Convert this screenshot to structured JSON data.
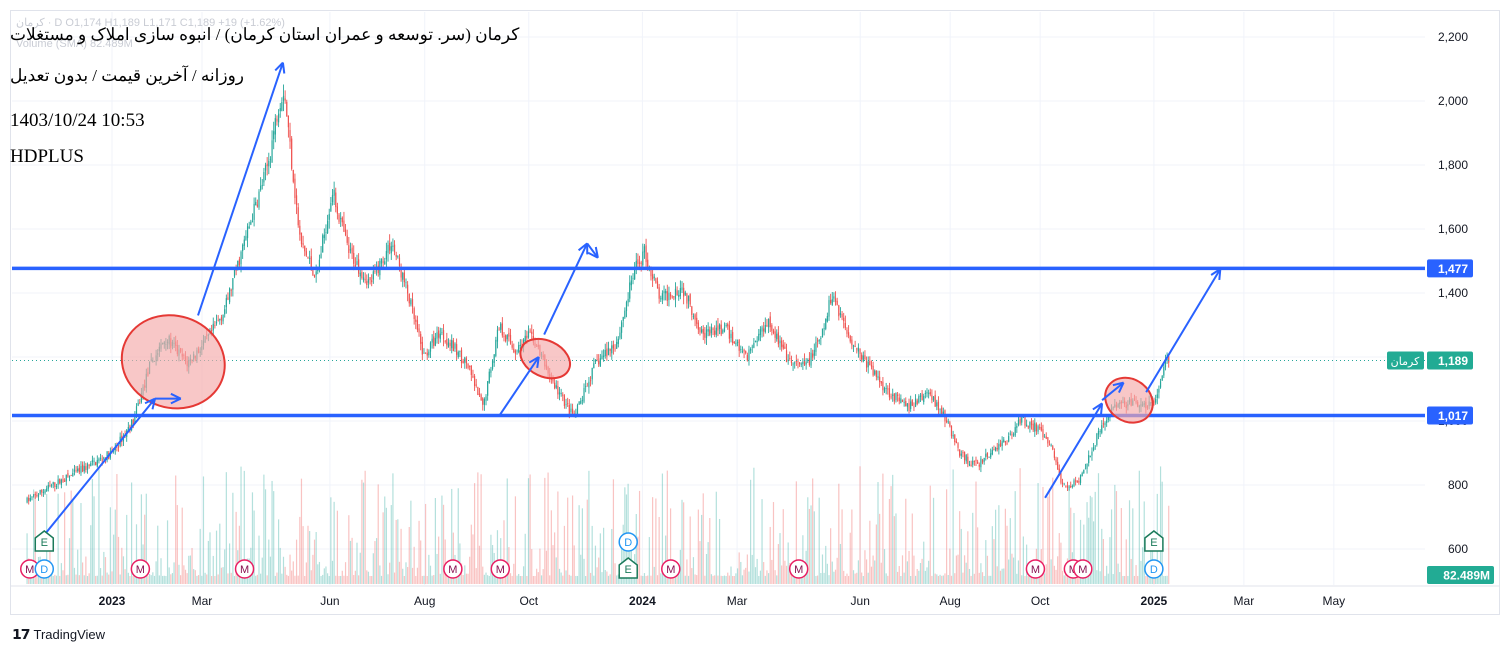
{
  "header": {
    "ohlc_ghost": "کرمان · D  O1,174  H1,189  L1,171  C1,189  +19 (+1.62%)",
    "volume_ghost": "Volume (SMA)  82.489M",
    "title": "کرمان (سر. توسعه و عمران استان کرمان) / انبوه سازی املاک و مستغلات",
    "subtitle": "روزانه / آخرین قیمت / بدون تعدیل",
    "datetime": "1403/10/24 10:53",
    "watermark": "HDPLUS"
  },
  "footer": {
    "brand": "TradingView"
  },
  "colors": {
    "up": "#26a69a",
    "down": "#ef5350",
    "level_line": "#2962ff",
    "annotation": "#2962ff",
    "ellipse_fill": "#f4a9a9",
    "ellipse_stroke": "#e53935",
    "grid": "#f0f3fa",
    "axis_text": "#131722",
    "badge_blue": "#2962ff",
    "badge_green": "#22ab94"
  },
  "chart_data": {
    "type": "candlestick",
    "symbol": "کرمان",
    "interval": "daily",
    "ylim": [
      540,
      2270
    ],
    "y_ticks": [
      600,
      800,
      1000,
      1200,
      1400,
      1600,
      1800,
      2000,
      2200
    ],
    "y_tick_labels": [
      "600",
      "800",
      "1,000",
      "1,200",
      "1,400",
      "1,600",
      "1,800",
      "2,000",
      "2,200"
    ],
    "x_tick_labels": [
      {
        "label": "2023",
        "bold": true,
        "t": 0.0
      },
      {
        "label": "Mar",
        "bold": false,
        "t": 0.0837
      },
      {
        "label": "Jun",
        "bold": false,
        "t": 0.2027
      },
      {
        "label": "Aug",
        "bold": false,
        "t": 0.2909
      },
      {
        "label": "Oct",
        "bold": false,
        "t": 0.3877
      },
      {
        "label": "2024",
        "bold": true,
        "t": 0.4934
      },
      {
        "label": "Mar",
        "bold": false,
        "t": 0.5815
      },
      {
        "label": "Jun",
        "bold": false,
        "t": 0.696
      },
      {
        "label": "Aug",
        "bold": false,
        "t": 0.7797
      },
      {
        "label": "Oct",
        "bold": false,
        "t": 0.8634
      },
      {
        "label": "2025",
        "bold": true,
        "t": 0.9692
      },
      {
        "label": "Mar",
        "bold": false,
        "t": 1.0529
      },
      {
        "label": "May",
        "bold": false,
        "t": 1.1366
      }
    ],
    "price_path": [
      [
        -0.079,
        750
      ],
      [
        -0.06,
        790
      ],
      [
        -0.03,
        845
      ],
      [
        0.0,
        900
      ],
      [
        0.02,
        1000
      ],
      [
        0.035,
        1170
      ],
      [
        0.05,
        1260
      ],
      [
        0.07,
        1180
      ],
      [
        0.09,
        1260
      ],
      [
        0.105,
        1350
      ],
      [
        0.125,
        1580
      ],
      [
        0.145,
        1800
      ],
      [
        0.155,
        1990
      ],
      [
        0.16,
        2040
      ],
      [
        0.175,
        1560
      ],
      [
        0.19,
        1450
      ],
      [
        0.205,
        1720
      ],
      [
        0.22,
        1530
      ],
      [
        0.24,
        1430
      ],
      [
        0.26,
        1560
      ],
      [
        0.275,
        1400
      ],
      [
        0.29,
        1200
      ],
      [
        0.305,
        1280
      ],
      [
        0.33,
        1180
      ],
      [
        0.345,
        1040
      ],
      [
        0.36,
        1300
      ],
      [
        0.375,
        1220
      ],
      [
        0.39,
        1270
      ],
      [
        0.41,
        1120
      ],
      [
        0.43,
        1010
      ],
      [
        0.45,
        1180
      ],
      [
        0.47,
        1250
      ],
      [
        0.485,
        1460
      ],
      [
        0.495,
        1530
      ],
      [
        0.51,
        1380
      ],
      [
        0.53,
        1420
      ],
      [
        0.55,
        1270
      ],
      [
        0.57,
        1290
      ],
      [
        0.59,
        1200
      ],
      [
        0.61,
        1320
      ],
      [
        0.63,
        1180
      ],
      [
        0.645,
        1170
      ],
      [
        0.66,
        1260
      ],
      [
        0.67,
        1400
      ],
      [
        0.685,
        1270
      ],
      [
        0.7,
        1190
      ],
      [
        0.72,
        1100
      ],
      [
        0.74,
        1040
      ],
      [
        0.76,
        1090
      ],
      [
        0.775,
        1010
      ],
      [
        0.79,
        890
      ],
      [
        0.805,
        860
      ],
      [
        0.82,
        910
      ],
      [
        0.835,
        950
      ],
      [
        0.845,
        1005
      ],
      [
        0.86,
        980
      ],
      [
        0.875,
        910
      ],
      [
        0.885,
        790
      ],
      [
        0.9,
        820
      ],
      [
        0.915,
        940
      ],
      [
        0.93,
        1040
      ],
      [
        0.95,
        1060
      ],
      [
        0.96,
        1040
      ],
      [
        0.97,
        1060
      ],
      [
        0.98,
        1180
      ],
      [
        0.983,
        1189
      ]
    ],
    "volume_tallest_label": "82.489M",
    "levels": [
      {
        "price": 1477,
        "label": "1,477"
      },
      {
        "price": 1017,
        "label": "1,017"
      }
    ],
    "last_price": {
      "price": 1189,
      "label": "1,189",
      "symbol": "کرمان"
    },
    "volume_label": "82.489M",
    "event_markers": [
      {
        "t": -0.0765,
        "label": "M",
        "kind": "dividend-m",
        "row": 2
      },
      {
        "t": -0.063,
        "label": "E",
        "kind": "earnings",
        "row": 1
      },
      {
        "t": -0.063,
        "label": "D",
        "kind": "dividend",
        "row": 2
      },
      {
        "t": 0.0264,
        "label": "M",
        "kind": "dividend-m",
        "row": 2
      },
      {
        "t": 0.1233,
        "label": "M",
        "kind": "dividend-m",
        "row": 2
      },
      {
        "t": 0.3171,
        "label": "M",
        "kind": "dividend-m",
        "row": 2
      },
      {
        "t": 0.3612,
        "label": "M",
        "kind": "dividend-m",
        "row": 2
      },
      {
        "t": 0.4802,
        "label": "D",
        "kind": "dividend",
        "row": 1
      },
      {
        "t": 0.4802,
        "label": "E",
        "kind": "earnings",
        "row": 2
      },
      {
        "t": 0.5198,
        "label": "M",
        "kind": "dividend-m",
        "row": 2
      },
      {
        "t": 0.6388,
        "label": "M",
        "kind": "dividend-m",
        "row": 2
      },
      {
        "t": 0.859,
        "label": "M",
        "kind": "dividend-m",
        "row": 2
      },
      {
        "t": 0.8943,
        "label": "M",
        "kind": "dividend-m",
        "row": 2
      },
      {
        "t": 0.9031,
        "label": "M",
        "kind": "dividend-m",
        "row": 2
      },
      {
        "t": 0.9692,
        "label": "E",
        "kind": "earnings",
        "row": 1
      },
      {
        "t": 0.9692,
        "label": "D",
        "kind": "dividend",
        "row": 2
      }
    ],
    "annotations": {
      "arrows": [
        {
          "from": [
            -0.07,
            615
          ],
          "to": [
            0.04,
            1070
          ]
        },
        {
          "from": [
            0.04,
            1070
          ],
          "to": [
            0.064,
            1070
          ]
        },
        {
          "from": [
            0.08,
            1330
          ],
          "to": [
            0.159,
            2120
          ]
        },
        {
          "from": [
            0.361,
            1020
          ],
          "to": [
            0.397,
            1200
          ]
        },
        {
          "from": [
            0.402,
            1270
          ],
          "to": [
            0.442,
            1555
          ]
        },
        {
          "from": [
            0.442,
            1555
          ],
          "to": [
            0.452,
            1510
          ]
        },
        {
          "from": [
            0.868,
            760
          ],
          "to": [
            0.921,
            1055
          ]
        },
        {
          "from": [
            0.921,
            1065
          ],
          "to": [
            0.941,
            1120
          ]
        },
        {
          "from": [
            0.962,
            1090
          ],
          "to": [
            1.031,
            1475
          ]
        }
      ],
      "ellipses": [
        {
          "t": 0.057,
          "p": 1185,
          "rx": 52,
          "ry": 46,
          "rot": 18
        },
        {
          "t": 0.403,
          "p": 1195,
          "rx": 26,
          "ry": 18,
          "rot": 25
        },
        {
          "t": 0.946,
          "p": 1065,
          "rx": 25,
          "ry": 21,
          "rot": 35
        }
      ]
    }
  }
}
